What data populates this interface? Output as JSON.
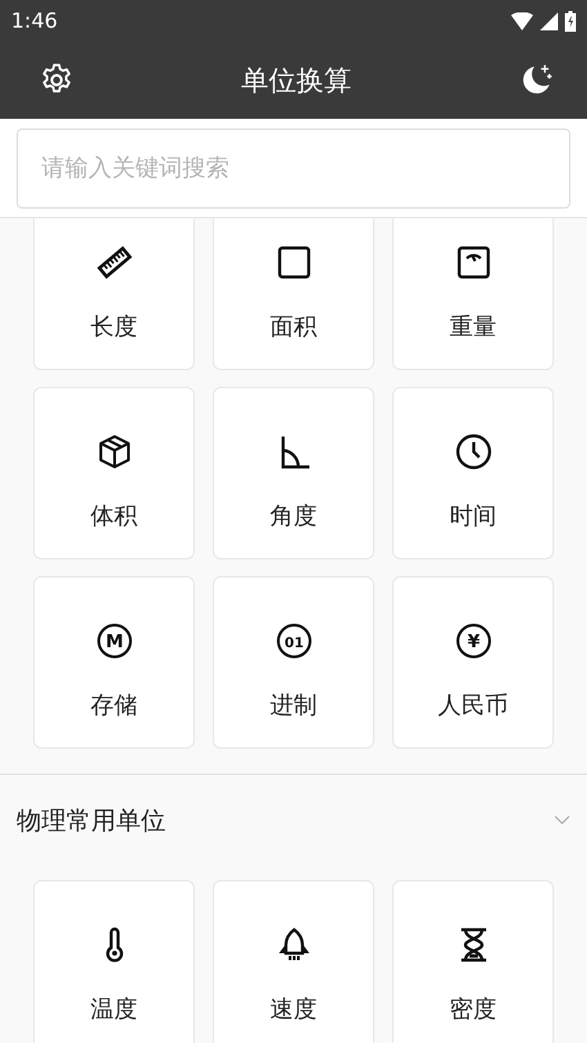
{
  "status_bar": {
    "time": "1:46"
  },
  "app_bar": {
    "title": "单位换算"
  },
  "search": {
    "placeholder": "请输入关键词搜索"
  },
  "common_units": [
    {
      "label": "长度"
    },
    {
      "label": "面积"
    },
    {
      "label": "重量"
    },
    {
      "label": "体积"
    },
    {
      "label": "角度"
    },
    {
      "label": "时间"
    },
    {
      "label": "存储",
      "symbol": "M"
    },
    {
      "label": "进制",
      "symbol": "01"
    },
    {
      "label": "人民币",
      "symbol": "¥"
    }
  ],
  "physics_section": {
    "title": "物理常用单位",
    "expanded": true,
    "units": [
      {
        "label": "温度"
      },
      {
        "label": "速度"
      },
      {
        "label": "密度"
      }
    ]
  }
}
